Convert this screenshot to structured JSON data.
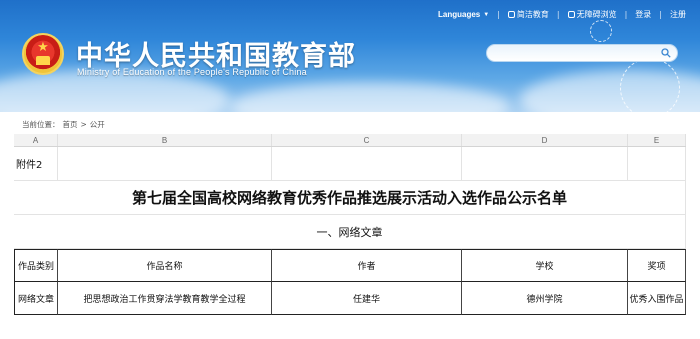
{
  "header": {
    "site_title": "中华人民共和国教育部",
    "site_subtitle": "Ministry of Education of the People's Republic of China",
    "nav": {
      "languages": "Languages",
      "links": [
        "简洁教育",
        "无障碍浏览",
        "登录",
        "注册"
      ]
    },
    "search": {
      "value": "",
      "placeholder": ""
    }
  },
  "breadcrumb": {
    "prefix": "当前位置：",
    "items": [
      "首页",
      "公开"
    ]
  },
  "sheet": {
    "columns": [
      "A",
      "B",
      "C",
      "D",
      "E"
    ],
    "attachment_label": "附件2",
    "title": "第七届全国高校网络教育优秀作品推选展示活动入选作品公示名单",
    "section": "一、网络文章",
    "table_headers": [
      "作品类别",
      "作品名称",
      "作者",
      "学校",
      "奖项"
    ],
    "rows": [
      [
        "网络文章",
        "把思想政治工作贯穿法学教育教学全过程",
        "任建华",
        "德州学院",
        "优秀入围作品"
      ]
    ]
  },
  "colors": {
    "banner_top": "#1f70c9",
    "banner_bottom": "#a9d0f2",
    "emblem_red": "#c81d16",
    "emblem_gold": "#f4d35e"
  }
}
